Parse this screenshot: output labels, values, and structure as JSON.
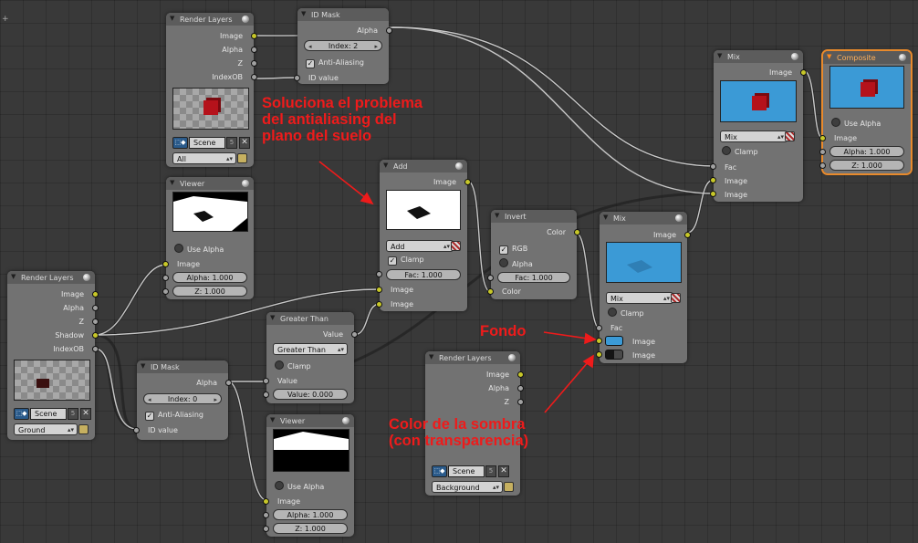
{
  "editor": {
    "corner_glyph": "+"
  },
  "colors": {
    "socket_image": "#c7c729",
    "socket_value": "#a1a1a1",
    "annotation": "#ee1b1b",
    "active_node": "#e88a2c",
    "blue_bg": "#3b9ad6"
  },
  "annotations": {
    "antialias": [
      "Soluciona el problema",
      "del antialiasing del",
      "plano del suelo"
    ],
    "fondo": "Fondo",
    "shadow_color": [
      "Color de la sombra",
      "(con transparencia)"
    ]
  },
  "nodes": {
    "render_layers_top": {
      "title": "Render Layers",
      "outputs": [
        "Image",
        "Alpha",
        "Z",
        "IndexOB"
      ],
      "scene": "Scene",
      "scene_users": "5",
      "layer": "All"
    },
    "id_mask_top": {
      "title": "ID Mask",
      "output": "Alpha",
      "index": "Index: 2",
      "anti_aliasing": "Anti-Aliasing",
      "input": "ID value"
    },
    "viewer_top": {
      "title": "Viewer",
      "use_alpha": "Use Alpha",
      "inputs": [
        "Image"
      ],
      "alpha": "Alpha: 1.000",
      "z": "Z: 1.000"
    },
    "render_layers_left": {
      "title": "Render Layers",
      "outputs": [
        "Image",
        "Alpha",
        "Z",
        "Shadow",
        "IndexOB"
      ],
      "scene": "Scene",
      "scene_users": "5",
      "layer": "Ground"
    },
    "add": {
      "title": "Add",
      "output": "Image",
      "mode": "Add",
      "clamp": "Clamp",
      "fac": "Fac: 1.000",
      "inputs": [
        "Image",
        "Image"
      ]
    },
    "invert": {
      "title": "Invert",
      "output": "Color",
      "rgb": "RGB",
      "alpha": "Alpha",
      "fac": "Fac: 1.000",
      "input": "Color"
    },
    "mix_bottom": {
      "title": "Mix",
      "output": "Image",
      "mode": "Mix",
      "clamp": "Clamp",
      "inputs": [
        "Fac",
        "Image",
        "Image"
      ]
    },
    "mix_top": {
      "title": "Mix",
      "output": "Image",
      "mode": "Mix",
      "clamp": "Clamp",
      "inputs": [
        "Fac",
        "Image",
        "Image"
      ]
    },
    "composite": {
      "title": "Composite",
      "use_alpha": "Use Alpha",
      "input": "Image",
      "alpha": "Alpha: 1.000",
      "z": "Z: 1.000"
    },
    "greater_than": {
      "title": "Greater Than",
      "output": "Value",
      "mode": "Greater Than",
      "clamp": "Clamp",
      "input": "Value",
      "value": "Value: 0.000"
    },
    "id_mask_bottom": {
      "title": "ID Mask",
      "output": "Alpha",
      "index": "Index: 0",
      "anti_aliasing": "Anti-Aliasing",
      "input": "ID value"
    },
    "viewer_bottom": {
      "title": "Viewer",
      "use_alpha": "Use Alpha",
      "input": "Image",
      "alpha": "Alpha: 1.000",
      "z": "Z: 1.000"
    },
    "render_layers_bottom": {
      "title": "Render Layers",
      "outputs": [
        "Image",
        "Alpha",
        "Z"
      ],
      "scene": "Scene",
      "scene_users": "5",
      "layer": "Background"
    }
  }
}
